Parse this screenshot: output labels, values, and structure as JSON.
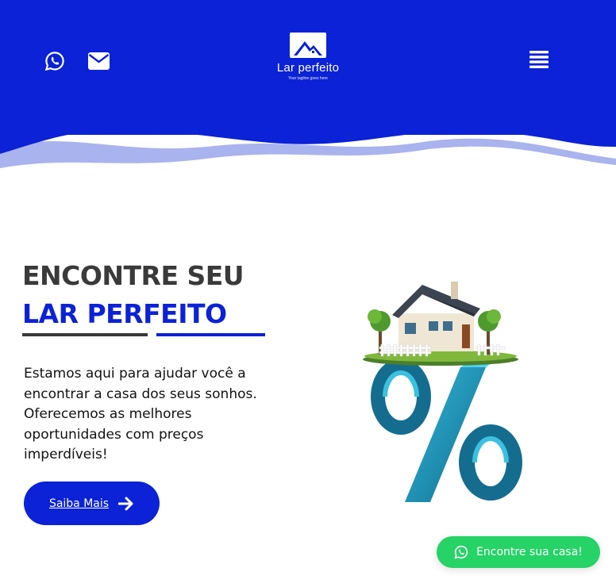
{
  "colors": {
    "brand_blue": "#0b22d6",
    "wave_light": "#a9b3ee",
    "heading_dark": "#3a3a3a",
    "whatsapp_green": "#25d366"
  },
  "header": {
    "icons": [
      "whatsapp-icon",
      "mail-icon",
      "hamburger-menu-icon"
    ],
    "logo": {
      "name": "Lar perfeito",
      "tagline": "Your tagline goes here"
    }
  },
  "hero": {
    "title_line1": "ENCONTRE SEU",
    "title_line2": "LAR PERFEITO",
    "description": "Estamos aqui para ajudar você a encontrar a casa dos seus sonhos. Oferecemos as melhores oportunidades com preços imperdíveis!",
    "cta_label": "Saiba Mais",
    "cta_icon": "arrow-right-icon",
    "illustration": "house-on-percent-sign"
  },
  "floating_button": {
    "label": "Encontre sua casa!",
    "icon": "whatsapp-icon"
  }
}
